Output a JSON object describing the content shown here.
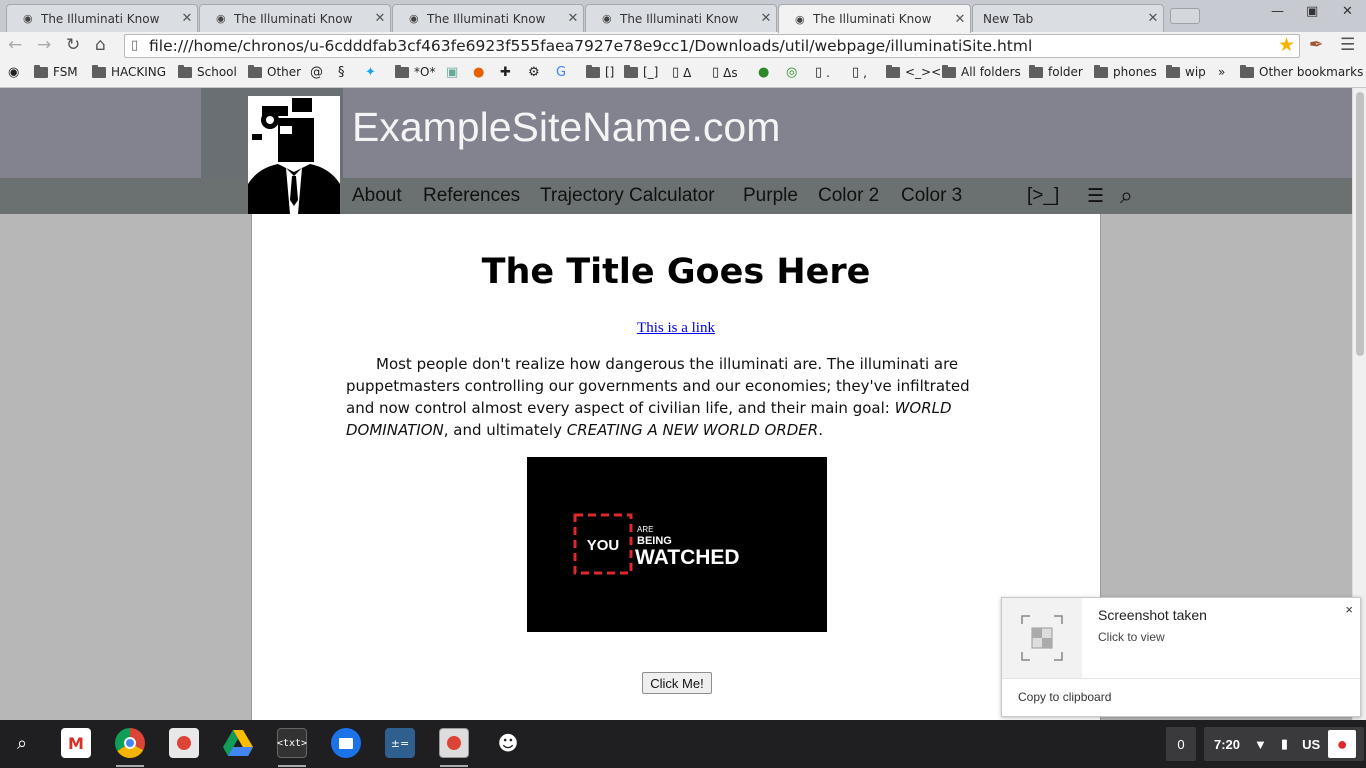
{
  "browser": {
    "tabs": [
      {
        "title": "The Illuminati Know",
        "active": false
      },
      {
        "title": "The Illuminati Know",
        "active": false
      },
      {
        "title": "The Illuminati Know",
        "active": false
      },
      {
        "title": "The Illuminati Know",
        "active": false
      },
      {
        "title": "The Illuminati Know",
        "active": true
      },
      {
        "title": "New Tab",
        "active": false
      }
    ],
    "url": "file:///home/chronos/u-6cdddfab3cf463fe6923f555faea7927e78e9cc1/Downloads/util/webpage/illuminatiSite.html",
    "bookmarks": [
      "FSM",
      "HACKING",
      "School",
      "Other",
      "*O*",
      "[]",
      "[_]",
      "Δ",
      "Δs",
      ".",
      ",",
      "<_><",
      "All folders",
      "folder",
      "phones",
      "wip",
      "»",
      "Other bookmarks"
    ]
  },
  "site": {
    "name": "ExampleSiteName.com",
    "nav": [
      "About",
      "References",
      "Trajectory Calculator",
      "Purple",
      "Color 2",
      "Color 3",
      "[>_]",
      "☰",
      "⌕"
    ],
    "title": "The Title Goes Here",
    "link_text": "This is a link",
    "para": {
      "p1": "Most people don't realize how dangerous the illuminati are. The illuminati are puppetmasters controlling our governments and our economies; they've infiltrated and now control almost every aspect of civilian life, and their main goal: ",
      "em1": "WORLD DOMINATION",
      "p2": ", and ultimately ",
      "em2": "CREATING A NEW WORLD ORDER",
      "p3": "."
    },
    "image_text": {
      "you": "YOU",
      "are": "ARE",
      "being": "BEING",
      "watched": "WATCHED"
    },
    "button_label": "Click Me!"
  },
  "notification": {
    "title": "Screenshot taken",
    "message": "Click to view",
    "action": "Copy to clipboard",
    "close": "×"
  },
  "shelf": {
    "tray_count": "0",
    "time": "7:20",
    "locale": "US"
  },
  "colors": {
    "header_bg": "#838390",
    "nav_bg": "#6b7170",
    "link": "#0000ee",
    "accent_red": "#e1262c"
  }
}
